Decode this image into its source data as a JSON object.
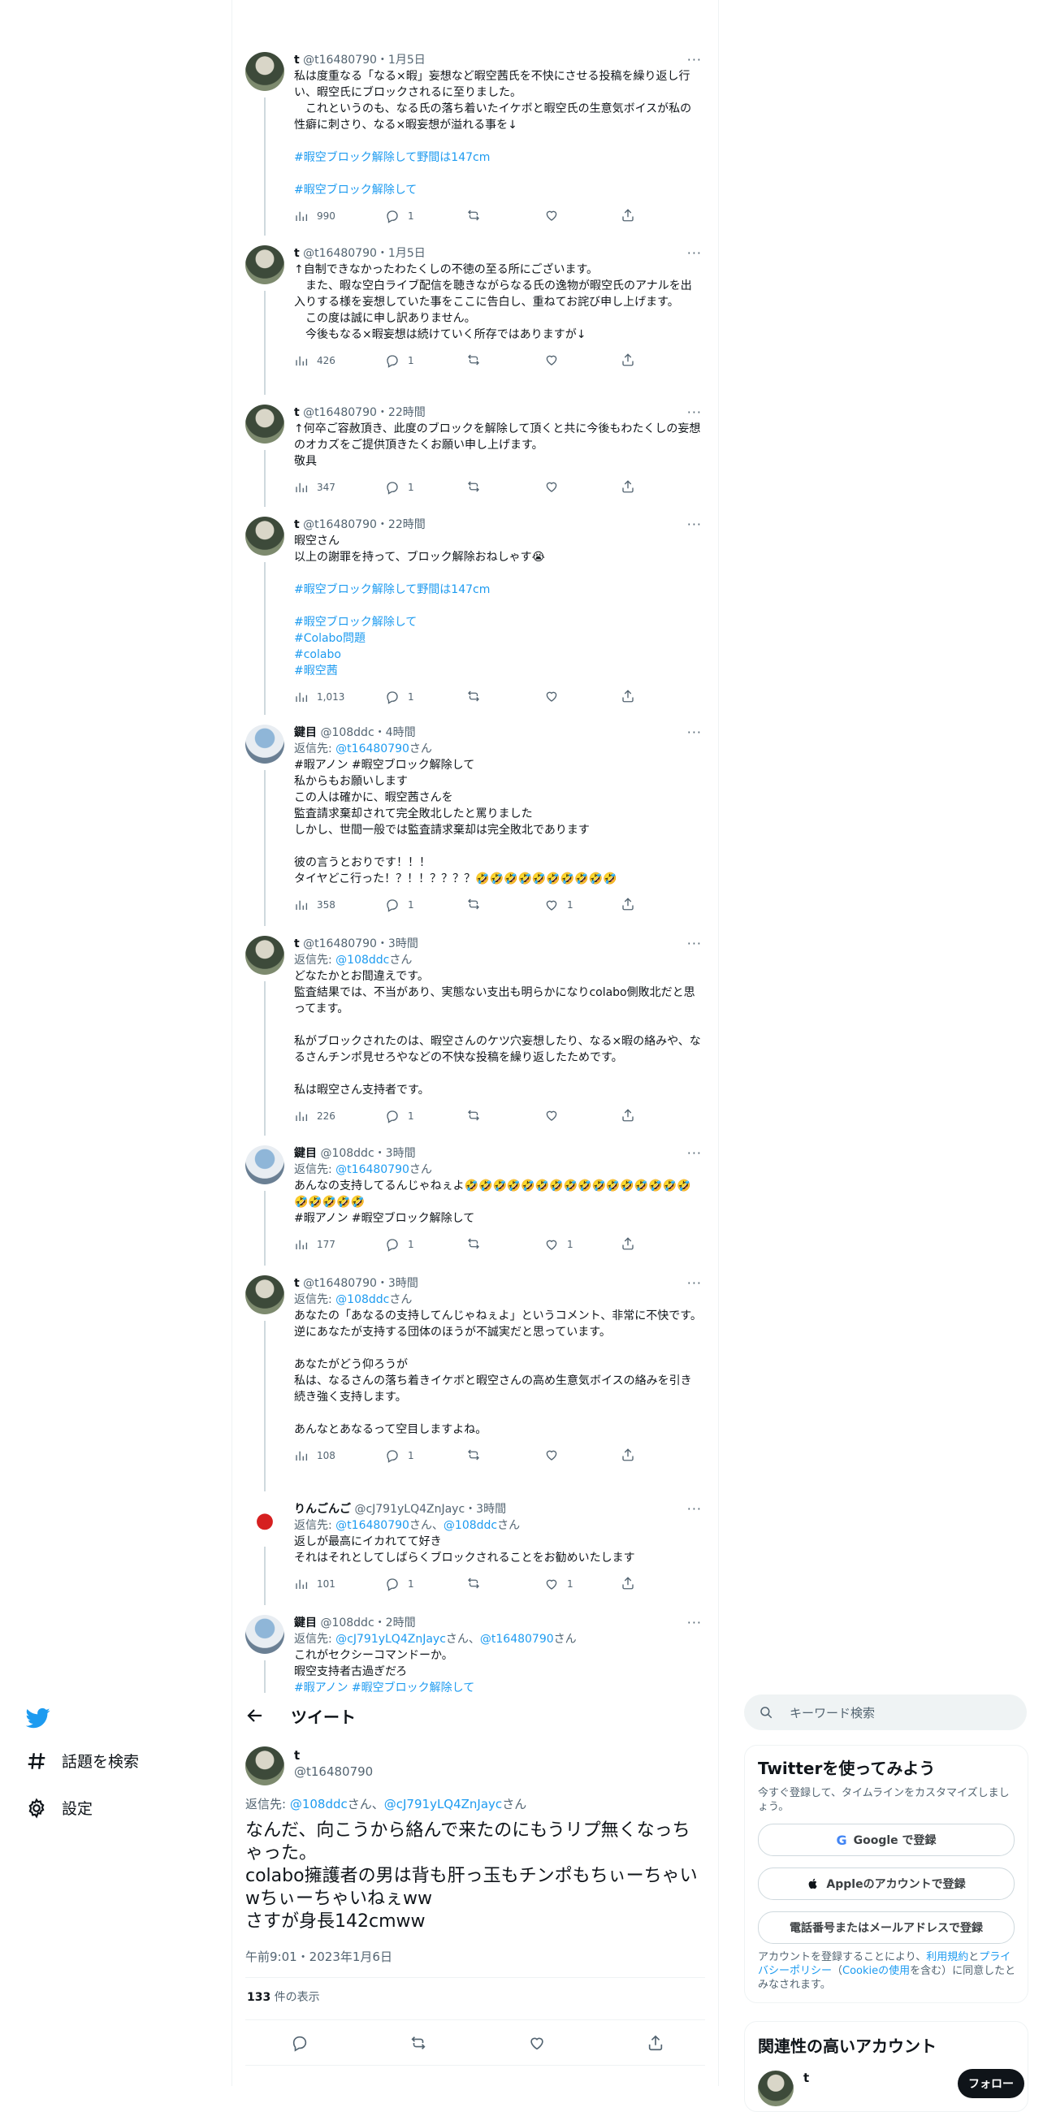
{
  "thread": [
    {
      "avatar": "t-avatar",
      "name": "t",
      "handle": "@t16480790",
      "time": "1月5日",
      "reply_to": [],
      "text": "私は度重なる「なる×暇」妄想など暇空茜氏を不快にさせる投稿を繰り返し行い、暇空氏にブロックされるに至りました。\n　これというのも、なる氏の落ち着いたイケボと暇空氏の生意気ボイスが私の性癖に刺さり、なる×暇妄想が溢れる事を↓",
      "hashtags": [
        "",
        "#暇空ブロック解除して野間は147cm",
        "",
        "#暇空ブロック解除して"
      ],
      "views": "990",
      "replies": "1",
      "retweets": "",
      "likes": ""
    },
    {
      "avatar": "t-avatar",
      "name": "t",
      "handle": "@t16480790",
      "time": "1月5日",
      "reply_to": [],
      "text": "↑自制できなかったわたくしの不徳の至る所にございます。\n　また、暇な空白ライブ配信を聴きながらなる氏の逸物が暇空氏のアナルを出入りする様を妄想していた事をここに告白し、重ねてお詫び申し上げます。\n　この度は誠に申し訳ありません。\n　今後もなる×暇妄想は続けていく所存ではありますが↓",
      "hashtags": [],
      "views": "426",
      "replies": "1",
      "retweets": "",
      "likes": ""
    },
    {
      "avatar": "t-avatar",
      "name": "t",
      "handle": "@t16480790",
      "time": "22時間",
      "reply_to": [],
      "text": "↑何卒ご容赦頂き、此度のブロックを解除して頂くと共に今後もわたくしの妄想のオカズをご提供頂きたくお願い申し上げます。\n敬具",
      "hashtags": [],
      "views": "347",
      "replies": "1",
      "retweets": "",
      "likes": ""
    },
    {
      "avatar": "t-avatar",
      "name": "t",
      "handle": "@t16480790",
      "time": "22時間",
      "reply_to": [],
      "text": "暇空さん\n以上の謝罪を持って、ブロック解除おねしゃす😭",
      "hashtags": [
        "",
        "#暇空ブロック解除して野間は147cm",
        "",
        "#暇空ブロック解除して",
        "#Colabo問題",
        "#colabo",
        "#暇空茜"
      ],
      "views": "1,013",
      "replies": "1",
      "retweets": "",
      "likes": ""
    },
    {
      "avatar": "kagi-avatar",
      "name": "鍵目",
      "handle": "@108ddc",
      "time": "4時間",
      "reply_to": [
        "@t16480790"
      ],
      "tags_line": "#暇アノン #暇空ブロック解除して",
      "text": "私からもお願いします\nこの人は確かに、暇空茜さんを\n監査請求棄却されて完全敗北したと罵りました\nしかし、世間一般では監査請求棄却は完全敗北であります\n\n彼の言うとおりです！！！\nタイヤどこ行った！？！！？？？？🤣🤣🤣🤣🤣🤣🤣🤣🤣🤣",
      "hashtags": [],
      "views": "358",
      "replies": "1",
      "retweets": "",
      "likes": "1"
    },
    {
      "avatar": "t-avatar",
      "name": "t",
      "handle": "@t16480790",
      "time": "3時間",
      "reply_to": [
        "@108ddc"
      ],
      "text": "どなたかとお間違えです。\n監査結果では、不当があり、実態ない支出も明らかになりcolabo側敗北だと思ってます。\n\n私がブロックされたのは、暇空さんのケツ穴妄想したり、なる×暇の絡みや、なるさんチンポ見せろやなどの不快な投稿を繰り返したためです。\n\n私は暇空さん支持者です。",
      "hashtags": [],
      "views": "226",
      "replies": "1",
      "retweets": "",
      "likes": ""
    },
    {
      "avatar": "kagi-avatar",
      "name": "鍵目",
      "handle": "@108ddc",
      "time": "3時間",
      "reply_to": [
        "@t16480790"
      ],
      "text": "あんなの支持してるんじゃねぇよ🤣🤣🤣🤣🤣🤣🤣🤣🤣🤣🤣🤣🤣🤣🤣🤣🤣🤣🤣🤣🤣",
      "tags_after": "#暇アノン #暇空ブロック解除して",
      "hashtags": [],
      "views": "177",
      "replies": "1",
      "retweets": "",
      "likes": "1"
    },
    {
      "avatar": "t-avatar",
      "name": "t",
      "handle": "@t16480790",
      "time": "3時間",
      "reply_to": [
        "@108ddc"
      ],
      "text": "あなたの「あなるの支持してんじゃねぇよ」というコメント、非常に不快です。\n逆にあなたが支持する団体のほうが不誠実だと思っています。\n\nあなたがどう仰ろうが\n私は、なるさんの落ち着きイケボと暇空さんの高め生意気ボイスの絡みを引き続き強く支持します。\n\nあんなとあなるって空目しますよね。",
      "hashtags": [],
      "views": "108",
      "replies": "1",
      "retweets": "",
      "likes": ""
    },
    {
      "avatar": "ringo-avatar",
      "name": "りんごんご",
      "handle": "@cJ791yLQ4ZnJayc",
      "time": "3時間",
      "reply_to": [
        "@t16480790",
        "@108ddc"
      ],
      "text": "返しが最高にイカれてて好き\nそれはそれとしてしばらくブロックされることをお勧めいたします",
      "hashtags": [],
      "views": "101",
      "replies": "1",
      "retweets": "",
      "likes": "1"
    },
    {
      "avatar": "kagi-avatar",
      "name": "鍵目",
      "handle": "@108ddc",
      "time": "2時間",
      "reply_to": [
        "@cJ791yLQ4ZnJayc",
        "@t16480790"
      ],
      "text": "これがセクシーコマンドーか。\n暇空支持者古過ぎだろ\n#暇アノン #暇空ブロック解除して",
      "hashtags": [],
      "views": "",
      "replies": "",
      "retweets": "",
      "likes": ""
    }
  ],
  "labels": {
    "reply_prefix": "返信先: ",
    "reply_suffix": "さん",
    "and": "、"
  },
  "nav": {
    "logo": "twitter-bird-icon",
    "explore": "話題を検索",
    "settings": "設定"
  },
  "main_tweet": {
    "header_title": "ツイート",
    "name": "t",
    "handle": "@t16480790",
    "reply_line_prefix": "返信先: ",
    "reply_user1": "@108ddc",
    "reply_mid": "さん、",
    "reply_user2": "@cJ791yLQ4ZnJayc",
    "reply_suffix": "さん",
    "text": "なんだ、向こうから絡んで来たのにもうリプ無くなっちゃった。\ncolabo擁護者の男は背も肝っ玉もチンポもちぃーちゃいwちぃーちゃいねぇww\nさすが身長142cmww",
    "timestamp": "午前9:01・2023年1月6日",
    "views_count": "133",
    "views_label": " 件の表示"
  },
  "right": {
    "search_placeholder": "キーワード検索",
    "signup_title": "Twitterを使ってみよう",
    "signup_sub": "今すぐ登録して、タイムラインをカスタマイズしましょう。",
    "google_btn": "Google で登録",
    "apple_btn": "Appleのアカウントで登録",
    "phone_btn": "電話番号またはメールアドレスで登録",
    "legal_1": "アカウントを登録することにより、",
    "legal_terms": "利用規約",
    "legal_2": "と",
    "legal_privacy": "プライバシーポリシー",
    "legal_3": "（",
    "legal_cookie": "Cookieの使用",
    "legal_4": "を含む）に同意したとみなされます。",
    "related_title": "関連性の高いアカウント",
    "related_name": "t",
    "follow_btn": "フォロー"
  },
  "colors": {
    "accent": "#1d9bf0",
    "text": "#0f1419",
    "muted": "#536471",
    "border": "#eff3f4"
  }
}
